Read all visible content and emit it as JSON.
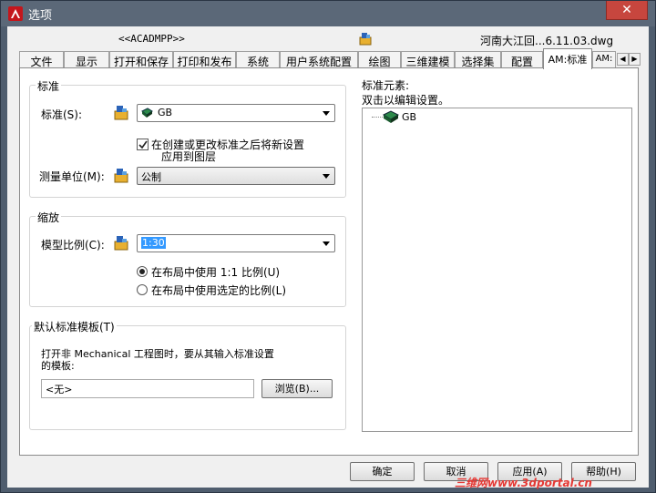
{
  "window": {
    "title": "选项",
    "close_glyph": "✕"
  },
  "profile": {
    "current_profile": "<<ACADMPP>>",
    "drawing": "河南大江回...6.11.03.dwg"
  },
  "tabs": [
    {
      "label": "文件"
    },
    {
      "label": "显示"
    },
    {
      "label": "打开和保存"
    },
    {
      "label": "打印和发布"
    },
    {
      "label": "系统"
    },
    {
      "label": "用户系统配置"
    },
    {
      "label": "绘图"
    },
    {
      "label": "三维建模"
    },
    {
      "label": "选择集"
    },
    {
      "label": "配置"
    },
    {
      "label": "AM:标准"
    },
    {
      "label": "AM:"
    }
  ],
  "tab_scroll": {
    "left": "◀",
    "right": "▶"
  },
  "standard_group": {
    "title": "标准",
    "standard_label": "标准(S):",
    "standard_value": "GB",
    "checkbox_label_line1": "在创建或更改标准之后将新设置",
    "checkbox_label_line2": "应用到图层",
    "checkbox_checked": true,
    "units_label": "测量单位(M):",
    "units_value": "公制"
  },
  "scale_group": {
    "title": "缩放",
    "model_scale_label": "模型比例(C):",
    "model_scale_value": "1:30",
    "radio1_label": "在布局中使用 1:1 比例(U)",
    "radio2_label": "在布局中使用选定的比例(L)",
    "selected_radio": 1
  },
  "template_group": {
    "title": "默认标准模板(T)",
    "description_line1": "打开非 Mechanical 工程图时，要从其输入标准设置",
    "description_line2": "的模板:",
    "template_value": "<无>",
    "browse_label": "浏览(B)..."
  },
  "elements": {
    "title_line1": "标准元素:",
    "title_line2": "双击以编辑设置。",
    "tree_items": [
      {
        "label": "GB"
      }
    ]
  },
  "footer": {
    "ok": "确定",
    "cancel": "取消",
    "apply": "应用(A)",
    "help": "帮助(H)"
  },
  "watermark": "三维网www.3dportal.cn",
  "colors": {
    "accent_red": "#c4161c",
    "selection_blue": "#3399ff"
  },
  "icons": [
    "autocad-app-icon",
    "profile-icon",
    "standards-book-icon",
    "standard-gb-icon"
  ]
}
